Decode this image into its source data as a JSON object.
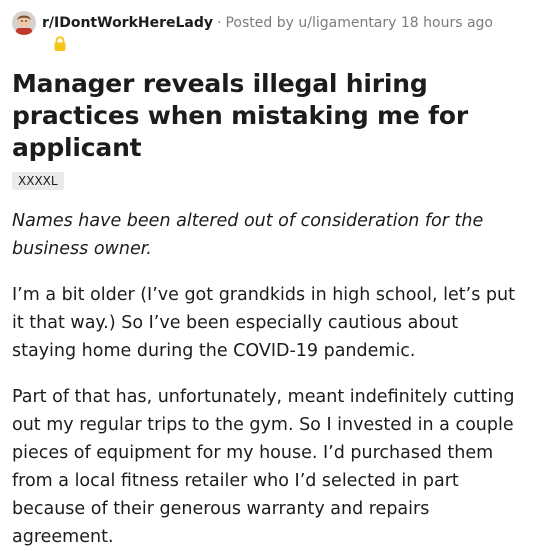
{
  "header": {
    "subreddit": "r/IDontWorkHereLady",
    "separator": "·",
    "posted_by_prefix": "Posted by",
    "username": "u/ligamentary",
    "time_ago": "18 hours ago",
    "avatar_icon": "subreddit-avatar-icon",
    "lock_icon": "lock-icon",
    "lock_color": "#f5c518"
  },
  "post": {
    "title": "Manager reveals illegal hiring practices when mistaking me for applicant",
    "flair": "XXXXL",
    "paragraphs": [
      "Names have been altered out of consideration for the business owner.",
      "I’m a bit older (I’ve got grandkids in high school, let’s put it that way.) So I’ve been especially cautious about staying home during the COVID-19 pandemic.",
      "Part of that has, unfortunately, meant indefinitely cutting out my regular trips to the gym. So I invested in a couple pieces of equipment for my house. I’d purchased them from a local fitness retailer who I’d selected in part because of their generous warranty and repairs agreement."
    ]
  }
}
